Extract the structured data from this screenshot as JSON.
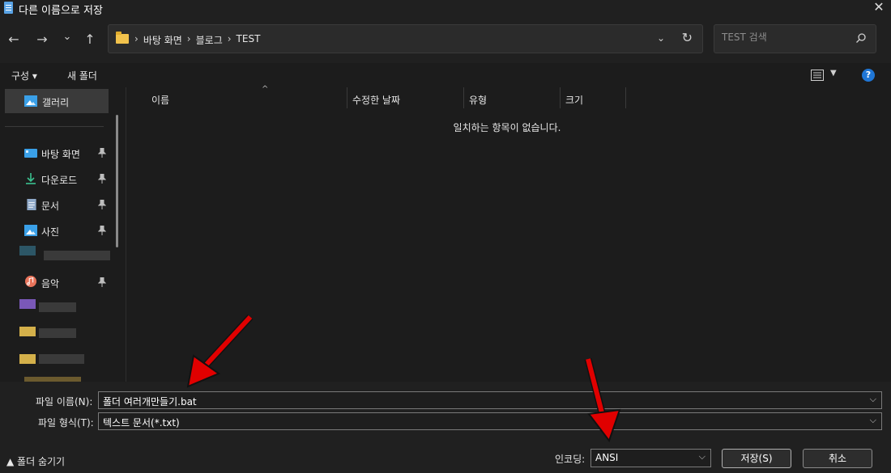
{
  "window": {
    "title": "다른 이름으로 저장",
    "close_glyph": "✕"
  },
  "nav": {
    "back_glyph": "←",
    "forward_glyph": "→",
    "history_glyph": "⌄",
    "up_glyph": "↑",
    "breadcrumbs": [
      "바탕 화면",
      "블로그",
      "TEST"
    ],
    "crumb_separator": "›",
    "dropdown_glyph": "⌄",
    "refresh_glyph": "↻",
    "search_placeholder": "TEST 검색"
  },
  "toolbar": {
    "organize_label": "구성 ▾",
    "new_folder_label": "새 폴더",
    "help_glyph": "?"
  },
  "sidebar": {
    "gallery_label": "갤러리",
    "items": [
      {
        "label": "바탕 화면",
        "icon": "desktop-icon"
      },
      {
        "label": "다운로드",
        "icon": "download-icon"
      },
      {
        "label": "문서",
        "icon": "document-icon"
      },
      {
        "label": "사진",
        "icon": "picture-icon"
      },
      {
        "label": "음악",
        "icon": "music-icon"
      }
    ]
  },
  "file_list": {
    "columns": [
      "이름",
      "수정한 날짜",
      "유형",
      "크기"
    ],
    "sort_glyph": "^",
    "empty_message": "일치하는 항목이 없습니다."
  },
  "save_form": {
    "filename_label": "파일 이름(N):",
    "filename_value": "폴더 여러개만들기.bat",
    "filetype_label": "파일 형식(T):",
    "filetype_value": "텍스트 문서(*.txt)",
    "dropdown_glyph": "⌵",
    "hide_folders_label": "▲ 폴더 숨기기",
    "encoding_label": "인코딩:",
    "encoding_value": "ANSI",
    "save_label": "저장(S)",
    "cancel_label": "취소"
  },
  "colors": {
    "accent": "#1f76d6",
    "annotation_arrow": "#e00000",
    "folder": "#f1c24c"
  }
}
